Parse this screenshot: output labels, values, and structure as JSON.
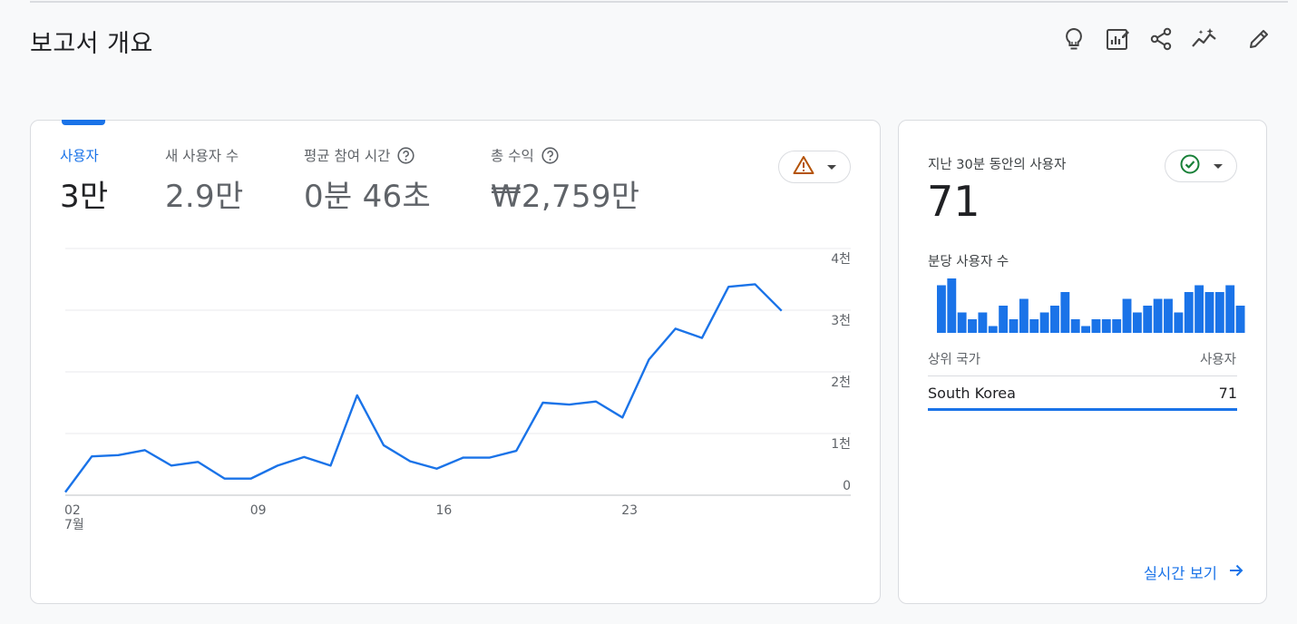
{
  "page": {
    "title": "보고서 개요"
  },
  "toolbar": {
    "icons": [
      "lightbulb-icon",
      "customize-report-icon",
      "share-icon",
      "insights-icon",
      "edit-icon"
    ]
  },
  "metrics": [
    {
      "label": "사용자",
      "value": "3만",
      "active": true,
      "help": false
    },
    {
      "label": "새 사용자 수",
      "value": "2.9만",
      "active": false,
      "help": false
    },
    {
      "label": "평균 참여 시간",
      "value": "0분 46초",
      "active": false,
      "help": true
    },
    {
      "label": "총 수익",
      "value": "₩2,759만",
      "active": false,
      "help": true
    }
  ],
  "colors": {
    "accent": "#1a73e8",
    "warning": "#c5221f",
    "success": "#188038",
    "border": "#dadce0"
  },
  "chart_data": {
    "type": "line",
    "x": [
      2,
      3,
      4,
      5,
      6,
      7,
      8,
      9,
      10,
      11,
      12,
      13,
      14,
      15,
      16,
      17,
      18,
      19,
      20,
      21,
      22,
      23,
      24,
      25,
      26,
      27,
      28,
      29,
      30
    ],
    "x_tick_labels": [
      {
        "x": 2,
        "label": "02",
        "sub": "7월"
      },
      {
        "x": 9,
        "label": "09"
      },
      {
        "x": 16,
        "label": "16"
      },
      {
        "x": 23,
        "label": "23"
      }
    ],
    "series": [
      {
        "values": [
          50,
          630,
          650,
          730,
          480,
          540,
          270,
          270,
          480,
          620,
          480,
          1620,
          810,
          550,
          430,
          610,
          610,
          720,
          1500,
          1470,
          1520,
          1260,
          2200,
          2700,
          2550,
          3380,
          3420,
          2990
        ],
        "color": "#1a73e8"
      }
    ],
    "ylim": [
      0,
      4000
    ],
    "y_ticks": [
      {
        "v": 0,
        "label": "0"
      },
      {
        "v": 1000,
        "label": "1천"
      },
      {
        "v": 2000,
        "label": "2천"
      },
      {
        "v": 3000,
        "label": "3천"
      },
      {
        "v": 4000,
        "label": "4천"
      }
    ],
    "grid": true
  },
  "realtime": {
    "title": "지난 30분 동안의 사용자",
    "value": "71",
    "per_minute_label": "분당 사용자 수",
    "per_minute_bars": [
      7,
      8,
      3,
      2,
      3,
      1,
      4,
      2,
      5,
      2,
      3,
      4,
      6,
      2,
      1,
      2,
      2,
      2,
      5,
      3,
      4,
      5,
      5,
      3,
      6,
      7,
      6,
      6,
      7,
      4
    ],
    "table": {
      "col_country": "상위 국가",
      "col_users": "사용자",
      "rows": [
        {
          "country": "South Korea",
          "users": "71"
        }
      ]
    },
    "link": "실시간 보기"
  }
}
